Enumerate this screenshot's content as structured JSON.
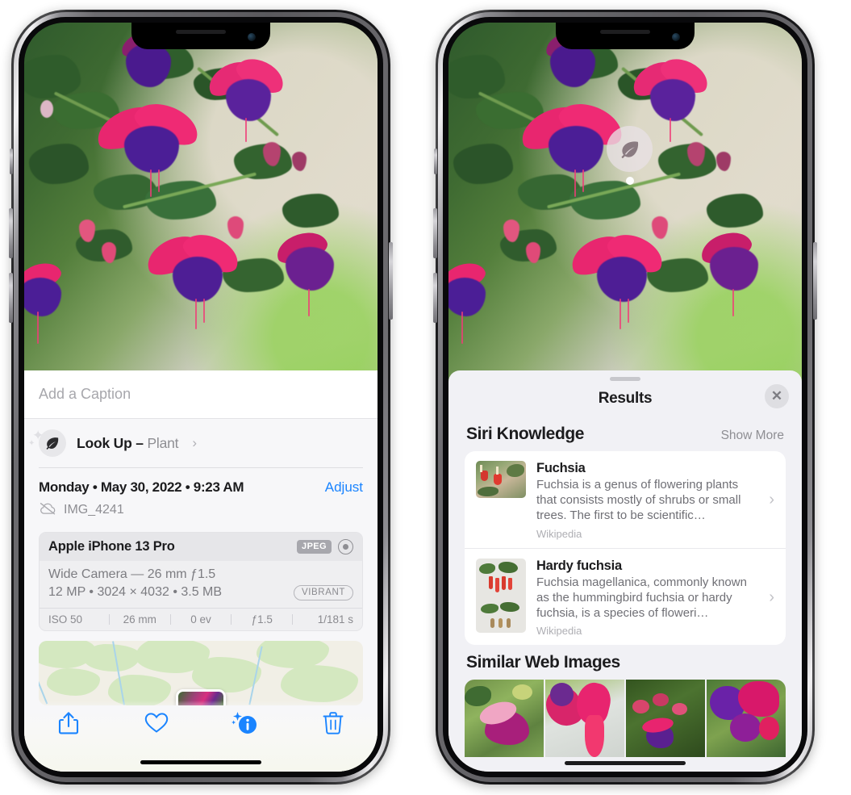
{
  "left_phone": {
    "caption_placeholder": "Add a Caption",
    "lookup": {
      "label": "Look Up",
      "dash": " – ",
      "subject": "Plant",
      "chevron": "›",
      "icon": "leaf-icon"
    },
    "meta": {
      "date": "Monday • May 30, 2022 • 9:23 AM",
      "adjust": "Adjust",
      "filename": "IMG_4241",
      "cloud_icon": "icloud-slash-icon"
    },
    "camera": {
      "device": "Apple iPhone 13 Pro",
      "format_tag": "JPEG",
      "aperture_icon": "aperture-icon",
      "lens": "Wide Camera — 26 mm ƒ1.5",
      "specs": "12 MP • 3024 × 4032 • 3.5 MB",
      "style_tag": "VIBRANT",
      "exif": [
        "ISO 50",
        "26 mm",
        "0 ev",
        "ƒ1.5",
        "1/181 s"
      ]
    },
    "toolbar": [
      {
        "name": "share-button",
        "icon": "share-icon"
      },
      {
        "name": "favorite-button",
        "icon": "heart-icon"
      },
      {
        "name": "info-button",
        "icon": "info-sparkle-icon"
      },
      {
        "name": "delete-button",
        "icon": "trash-icon"
      }
    ]
  },
  "right_phone": {
    "detection_badge": {
      "icon": "leaf-icon"
    },
    "sheet": {
      "title": "Results",
      "close_icon": "close-icon"
    },
    "siri_knowledge": {
      "heading": "Siri Knowledge",
      "show_more": "Show More",
      "items": [
        {
          "title": "Fuchsia",
          "description": "Fuchsia is a genus of flowering plants that consists mostly of shrubs or small trees. The first to be scientific…",
          "source": "Wikipedia",
          "chevron": "›"
        },
        {
          "title": "Hardy fuchsia",
          "description": "Fuchsia magellanica, commonly known as the hummingbird fuchsia or hardy fuchsia, is a species of floweri…",
          "source": "Wikipedia",
          "chevron": "›"
        }
      ]
    },
    "similar_web_images": {
      "heading": "Similar Web Images",
      "count": 4
    }
  },
  "colors": {
    "accent_blue": "#1a84ff",
    "sheet_bg": "#f1f1f5",
    "info_bg": "#f7f7f9",
    "card_bg": "#ffffff",
    "secondary_text": "#8e8e93"
  }
}
